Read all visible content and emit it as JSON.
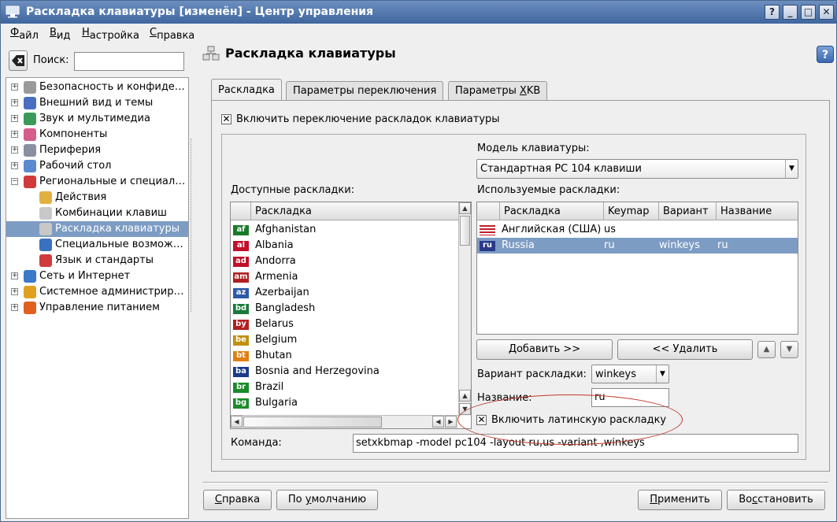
{
  "window": {
    "title": "Раскладка клавиатуры [изменён] - Центр управления"
  },
  "titlebar_buttons": [
    "?",
    "_",
    "□",
    "✕"
  ],
  "menu": [
    {
      "pre": "",
      "u": "Ф",
      "post": "айл"
    },
    {
      "pre": "",
      "u": "В",
      "post": "ид"
    },
    {
      "pre": "",
      "u": "Н",
      "post": "астройка"
    },
    {
      "pre": "",
      "u": "С",
      "post": "правка"
    }
  ],
  "search": {
    "label": "Поиск:",
    "value": ""
  },
  "tree": [
    {
      "label": "Безопасность и конфиде…",
      "icon_color": "#9a9a9a",
      "expandable": true,
      "level": 0
    },
    {
      "label": "Внешний вид и темы",
      "icon_color": "#4a6fc0",
      "expandable": true,
      "level": 0
    },
    {
      "label": "Звук и мультимедиа",
      "icon_color": "#3b9a5a",
      "expandable": true,
      "level": 0
    },
    {
      "label": "Компоненты",
      "icon_color": "#d65c8a",
      "expandable": true,
      "level": 0
    },
    {
      "label": "Периферия",
      "icon_color": "#8a8fa0",
      "expandable": true,
      "level": 0
    },
    {
      "label": "Рабочий стол",
      "icon_color": "#5a8ad0",
      "expandable": true,
      "level": 0
    },
    {
      "label": "Региональные и специал…",
      "icon_color": "#d03a3a",
      "expandable": true,
      "expanded": true,
      "level": 0
    },
    {
      "label": "Действия",
      "icon_color": "#e0b040",
      "expandable": false,
      "level": 1
    },
    {
      "label": "Комбинации клавиш",
      "icon_color": "#c8c8c8",
      "expandable": false,
      "level": 1
    },
    {
      "label": "Раскладка клавиатуры",
      "icon_color": "#c8c8c8",
      "expandable": false,
      "level": 1,
      "selected": true
    },
    {
      "label": "Специальные возмож…",
      "icon_color": "#3a70c0",
      "expandable": false,
      "level": 1
    },
    {
      "label": "Язык и стандарты",
      "icon_color": "#d03a3a",
      "expandable": false,
      "level": 1
    },
    {
      "label": "Сеть и Интернет",
      "icon_color": "#3a78c8",
      "expandable": true,
      "level": 0
    },
    {
      "label": "Системное администрир…",
      "icon_color": "#e0a020",
      "expandable": true,
      "level": 0
    },
    {
      "label": "Управление питанием",
      "icon_color": "#e06020",
      "expandable": true,
      "level": 0
    }
  ],
  "page": {
    "title": "Раскладка клавиатуры"
  },
  "tabs": [
    {
      "label": "Раскладка",
      "active": true
    },
    {
      "label": "Параметры переключения",
      "active": false
    },
    {
      "label": "Параметры XKB",
      "active": false
    }
  ],
  "enable_switch": {
    "label": "Включить переключение раскладок клавиатуры",
    "checked": true
  },
  "model": {
    "label": "Модель клавиатуры:",
    "value": "Стандартная PC 104 клавиши"
  },
  "available": {
    "label": "Доступные раскладки:",
    "column": "Раскладка",
    "items": [
      {
        "code": "af",
        "name": "Afghanistan",
        "color": "#1a7a2a"
      },
      {
        "code": "al",
        "name": "Albania",
        "color": "#c0102a"
      },
      {
        "code": "ad",
        "name": "Andorra",
        "color": "#c0102a"
      },
      {
        "code": "am",
        "name": "Armenia",
        "color": "#b02020"
      },
      {
        "code": "az",
        "name": "Azerbaijan",
        "color": "#2a5aa8"
      },
      {
        "code": "bd",
        "name": "Bangladesh",
        "color": "#1a7a3a"
      },
      {
        "code": "by",
        "name": "Belarus",
        "color": "#b02020"
      },
      {
        "code": "be",
        "name": "Belgium",
        "color": "#c09010"
      },
      {
        "code": "bt",
        "name": "Bhutan",
        "color": "#e08010"
      },
      {
        "code": "ba",
        "name": "Bosnia and Herzegovina",
        "color": "#1a3a8a"
      },
      {
        "code": "br",
        "name": "Brazil",
        "color": "#1a8a2a"
      },
      {
        "code": "bg",
        "name": "Bulgaria",
        "color": "#1a8a2a"
      }
    ]
  },
  "used": {
    "label": "Используемые раскладки:",
    "columns": [
      "Раскладка",
      "Keymap",
      "Вариант",
      "Название"
    ],
    "rows": [
      {
        "name": "Английская (США)",
        "keymap": "us",
        "variant": "",
        "title": "",
        "selected": false
      },
      {
        "name": "Russia",
        "keymap": "ru",
        "variant": "winkeys",
        "title": "ru",
        "selected": true
      }
    ]
  },
  "buttons": {
    "add": "Добавить >>",
    "remove": "<< Удалить",
    "help": {
      "pre": "",
      "u": "С",
      "post": "правка"
    },
    "defaults": {
      "pre": "По ",
      "u": "у",
      "post": "молчанию"
    },
    "apply": {
      "pre": "",
      "u": "П",
      "post": "рименить"
    },
    "restore": {
      "pre": "Во",
      "u": "с",
      "post": "становить"
    }
  },
  "variant": {
    "label": "Вариант раскладки:",
    "value": "winkeys"
  },
  "name_field": {
    "label": "Название:",
    "value": "ru"
  },
  "latin": {
    "label": "Включить латинскую раскладку",
    "checked": true
  },
  "command": {
    "label": "Команда:",
    "value": "setxkbmap -model pc104 -layout ru,us -variant ,winkeys"
  }
}
